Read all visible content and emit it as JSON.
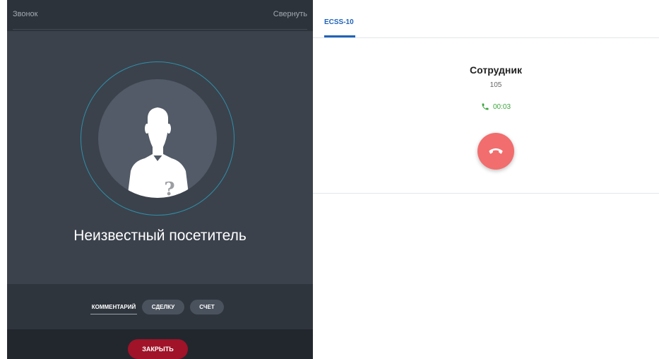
{
  "call_panel": {
    "title": "Звонок",
    "collapse_label": "Свернуть",
    "caller_name": "Неизвестный посетитель",
    "avatar_icon": "unknown-person-icon",
    "avatar_mark": "?",
    "tabs": [
      {
        "label": "КОММЕНТАРИЙ"
      },
      {
        "label": "СДЕЛКУ"
      },
      {
        "label": "СЧЕТ"
      }
    ],
    "close_label": "ЗАКРЫТЬ"
  },
  "phone_panel": {
    "tab_label": "ECSS-10",
    "contact_name": "Сотрудник",
    "contact_number": "105",
    "call_timer": "00:03",
    "call_icon": "phone-icon",
    "hangup_icon": "hangup-icon"
  },
  "colors": {
    "accent": "#1f62b9",
    "close_button": "#a01328",
    "hangup_button": "#f26d6d",
    "timer": "#3aa63a",
    "ring": "#2f8fa9"
  }
}
